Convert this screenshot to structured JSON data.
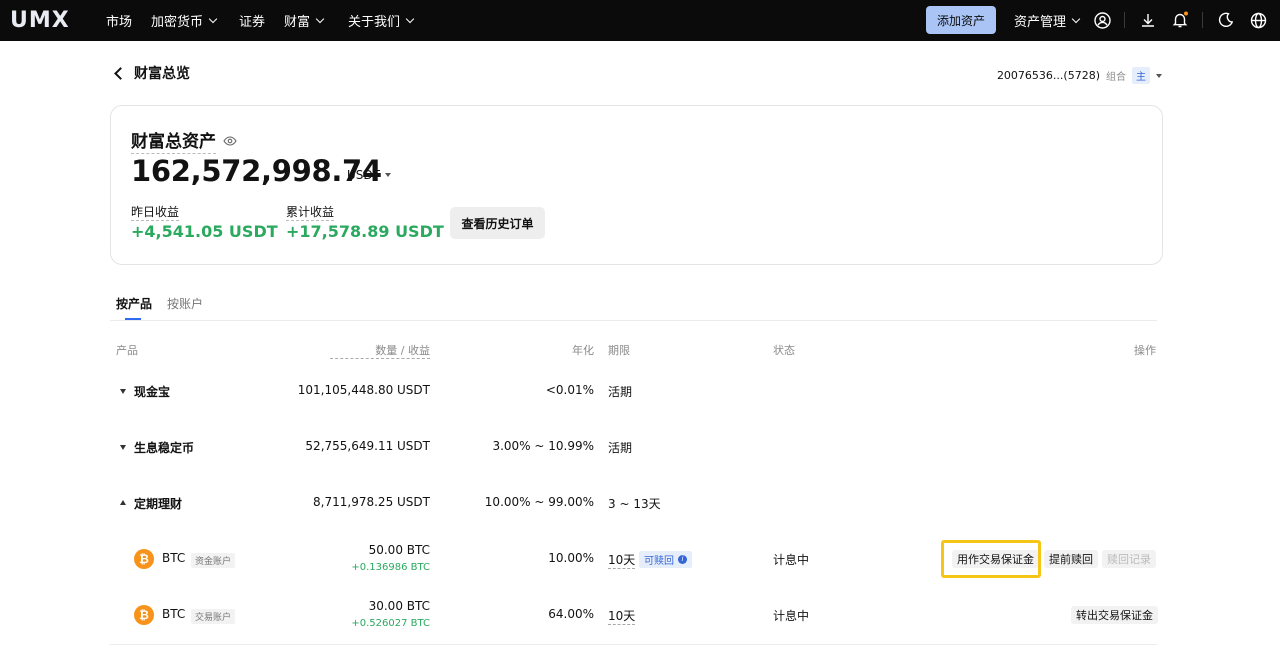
{
  "topbar": {
    "logo_text": "UMX",
    "nav": [
      "市场",
      "加密货币",
      "证券",
      "财富",
      "关于我们"
    ],
    "add_asset_label": "添加资产",
    "asset_mgmt_label": "资产管理",
    "icons": [
      "user-icon",
      "download-icon",
      "bell-icon",
      "moon-icon",
      "globe-icon"
    ],
    "notification_dot_color": "#f7931a"
  },
  "header": {
    "back_label": "财富总览",
    "account_id": "20076536...(5728)",
    "combo_label": "组合",
    "main_tag": "主"
  },
  "summary": {
    "title": "财富总资产",
    "total": "162,572,998.74",
    "unit": "USDT",
    "yesterday_label": "昨日收益",
    "yesterday_value": "+4,541.05 USDT",
    "cumulative_label": "累计收益",
    "cumulative_value": "+17,578.89 USDT",
    "history_button": "查看历史订单"
  },
  "tabs": [
    {
      "label": "按产品",
      "active": true
    },
    {
      "label": "按账户",
      "active": false
    }
  ],
  "table": {
    "headers": {
      "product": "产品",
      "amount": "数量 / 收益",
      "apr": "年化",
      "term": "期限",
      "status": "状态",
      "action": "操作"
    },
    "groups": [
      {
        "name": "现金宝",
        "amount": "101,105,448.80 USDT",
        "apr": "<0.01%",
        "term": "活期",
        "expanded": false
      },
      {
        "name": "生息稳定币",
        "amount": "52,755,649.11 USDT",
        "apr": "3.00% ~ 10.99%",
        "term": "活期",
        "expanded": false
      },
      {
        "name": "定期理财",
        "amount": "8,711,978.25 USDT",
        "apr": "10.00% ~ 99.00%",
        "term": "3 ~ 13天",
        "expanded": true
      }
    ],
    "rows": [
      {
        "coin": "BTC",
        "account_tag": "资金账户",
        "amount": "50.00 BTC",
        "earnings": "+0.136986 BTC",
        "apr": "10.00%",
        "term": "10天",
        "redeem_tag": "可赎回",
        "status": "计息中",
        "actions": [
          "用作交易保证金",
          "提前赎回",
          "赎回记录"
        ]
      },
      {
        "coin": "BTC",
        "account_tag": "交易账户",
        "amount": "30.00 BTC",
        "earnings": "+0.526027 BTC",
        "apr": "64.00%",
        "term": "10天",
        "status": "计息中",
        "actions": [
          "转出交易保证金"
        ]
      }
    ]
  },
  "colors": {
    "accent": "#2f6bf1",
    "positive": "#2aa95f",
    "highlight": "#f5c518",
    "add_asset_bg": "#a9c4f5"
  }
}
